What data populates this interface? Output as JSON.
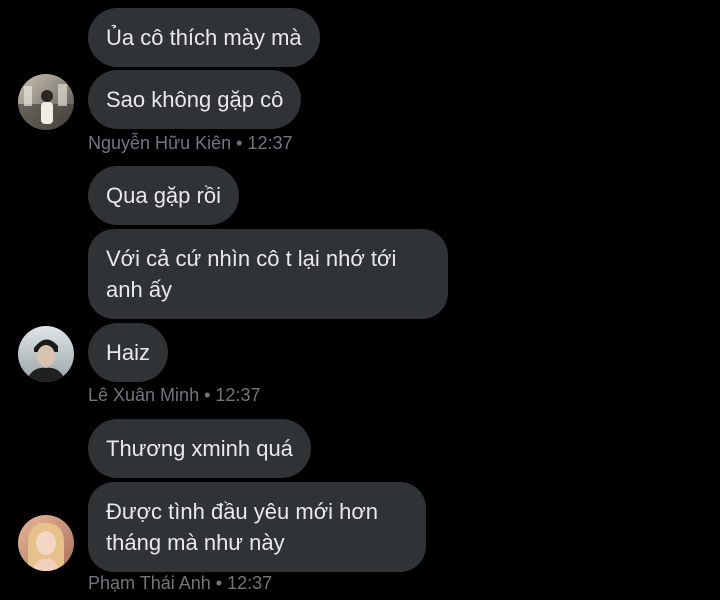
{
  "conversation": {
    "groups": [
      {
        "sender": "Nguyễn Hữu Kiên",
        "time": "12:37",
        "messages": [
          "Ủa cô thích mày mà",
          "Sao không gặp cô"
        ],
        "avatar": "avatar-nguyen-huu-kien"
      },
      {
        "sender": "Lê Xuân Minh",
        "time": "12:37",
        "messages": [
          "Qua gặp rồi",
          "Với cả cứ nhìn cô t lại nhớ tới anh ấy",
          "Haiz"
        ],
        "avatar": "avatar-le-xuan-minh"
      },
      {
        "sender": "Phạm Thái Anh",
        "time": "12:37",
        "messages": [
          "Thương xminh quá",
          "Được tình đầu yêu mới hơn tháng mà như này"
        ],
        "avatar": "avatar-pham-thai-anh"
      }
    ],
    "separator": "•"
  },
  "colors": {
    "background": "#000000",
    "bubble": "#2f3336",
    "text": "#e7e9ea",
    "meta": "#71767b"
  }
}
